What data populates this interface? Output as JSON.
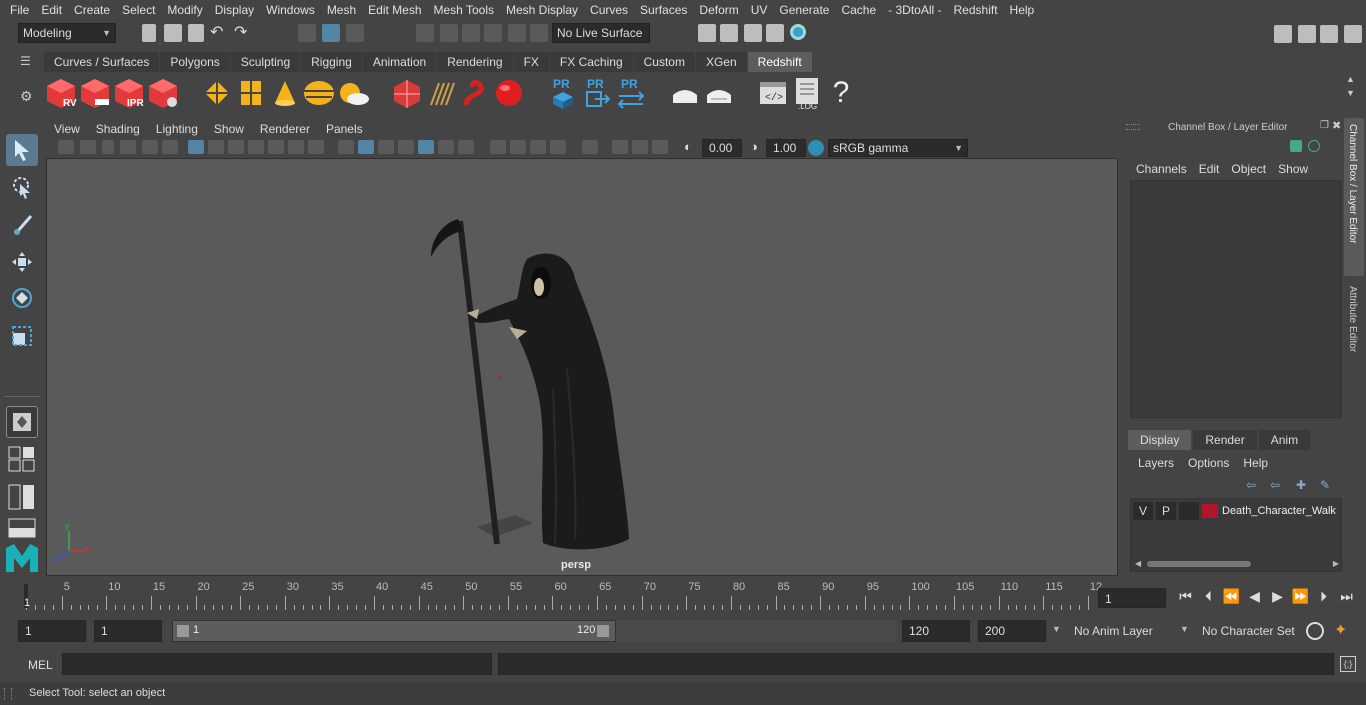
{
  "menubar": [
    "File",
    "Edit",
    "Create",
    "Select",
    "Modify",
    "Display",
    "Windows",
    "Mesh",
    "Edit Mesh",
    "Mesh Tools",
    "Mesh Display",
    "Curves",
    "Surfaces",
    "Deform",
    "UV",
    "Generate",
    "Cache",
    "- 3DtoAll -",
    "Redshift",
    "Help"
  ],
  "statusline": {
    "mode": "Modeling",
    "live_surface": "No Live Surface"
  },
  "shelf_tabs": [
    "Curves / Surfaces",
    "Polygons",
    "Sculpting",
    "Rigging",
    "Animation",
    "Rendering",
    "FX",
    "FX Caching",
    "Custom",
    "XGen",
    "Redshift"
  ],
  "shelf": {
    "rv_label": "RV",
    "ipr_label": "IPR",
    "pr1": "PR",
    "pr2": "PR",
    "pr3": "PR",
    "log_label": ".LOG",
    "help": "?"
  },
  "viewport": {
    "menu": [
      "View",
      "Shading",
      "Lighting",
      "Show",
      "Renderer",
      "Panels"
    ],
    "exposure": "0.00",
    "gamma": "1.00",
    "color_space": "sRGB gamma",
    "camera_label": "persp"
  },
  "channel_box": {
    "title": "Channel Box / Layer Editor",
    "menu": [
      "Channels",
      "Edit",
      "Object",
      "Show"
    ],
    "side_tab_1": "Channel Box / Layer Editor",
    "side_tab_2": "Attribute Editor"
  },
  "layer_editor": {
    "tabs": [
      "Display",
      "Render",
      "Anim"
    ],
    "menu": [
      "Layers",
      "Options",
      "Help"
    ],
    "layer": {
      "v": "V",
      "p": "P",
      "name": "Death_Character_Walk",
      "color": "#b0162a"
    }
  },
  "timeline": {
    "ticks": [
      "5",
      "10",
      "15",
      "20",
      "25",
      "30",
      "35",
      "40",
      "45",
      "50",
      "55",
      "60",
      "65",
      "70",
      "75",
      "80",
      "85",
      "90",
      "95",
      "100",
      "105",
      "110",
      "115",
      "12"
    ],
    "start_marker": "1",
    "current_frame": "1"
  },
  "range": {
    "start": "1",
    "inner_start": "1",
    "slider_start": "1",
    "slider_end": "120",
    "end": "120",
    "outer_end": "200",
    "anim_layer": "No Anim Layer",
    "character_set": "No Character Set"
  },
  "cmdline": {
    "lang": "MEL"
  },
  "helpline": {
    "text": "Select Tool: select an object"
  }
}
